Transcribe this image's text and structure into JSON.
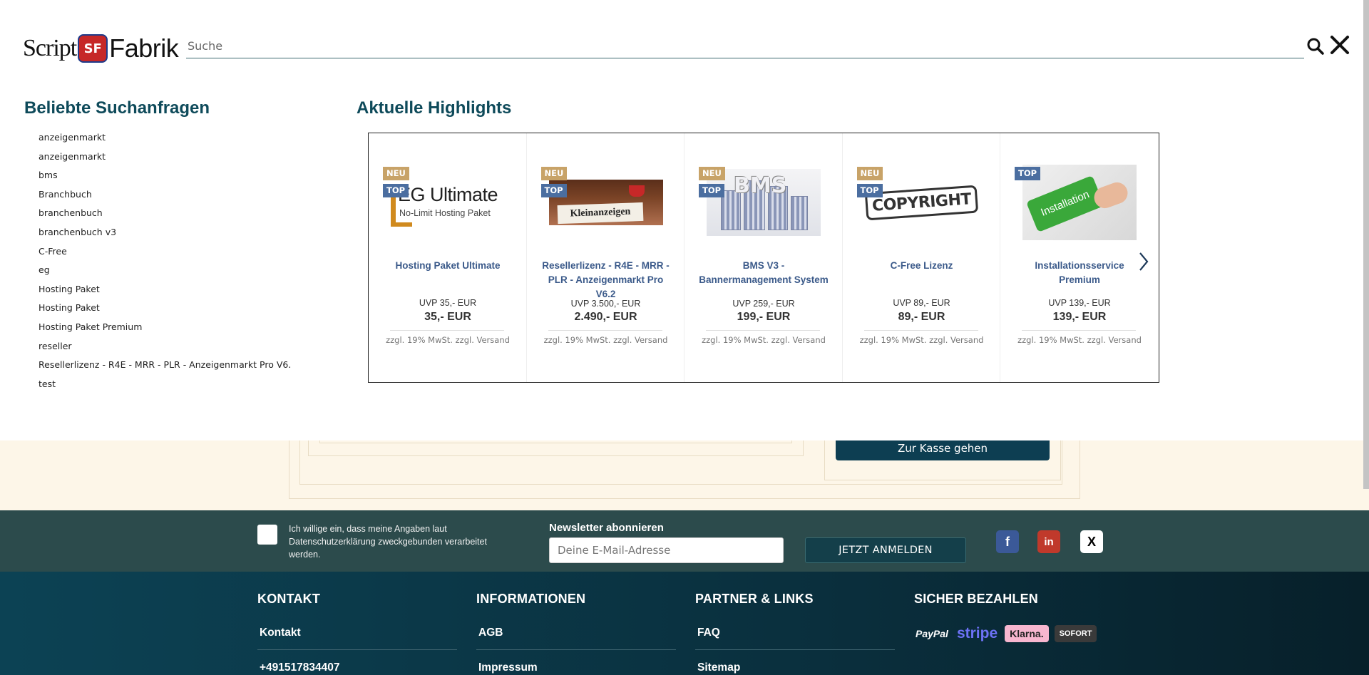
{
  "search": {
    "placeholder": "Suche",
    "logo_part1": "Script",
    "logo_badge": "SF",
    "logo_part2": "Fabrik"
  },
  "popular": {
    "title": "Beliebte Suchanfragen",
    "items": [
      "anzeigenmarkt",
      "anzeigenmarkt",
      "bms",
      "Branchbuch",
      "branchenbuch",
      "branchenbuch v3",
      "C-Free",
      "eg",
      "Hosting Paket",
      "Hosting Paket",
      "Hosting Paket Premium",
      "reseller",
      "Resellerlizenz - R4E - MRR - PLR - Anzeigenmarkt Pro V6.",
      "test"
    ]
  },
  "highlights": {
    "title": "Aktuelle Highlights",
    "products": [
      {
        "title": "Hosting Paket Ultimate",
        "uvp": "UVP 35,- EUR",
        "price": "35,- EUR",
        "tax": "zzgl. 19% MwSt. zzgl. Versand",
        "badge_neu": "NEU",
        "badge_top": "TOP",
        "img_title": "EG Ultimate",
        "img_sub": "No-Limit Hosting Paket"
      },
      {
        "title": "Resellerlizenz - R4E - MRR - PLR - Anzeigenmarkt Pro V6.2",
        "uvp": "UVP 3.500,- EUR",
        "price": "2.490,- EUR",
        "tax": "zzgl. 19% MwSt. zzgl. Versand",
        "badge_neu": "NEU",
        "badge_top": "TOP",
        "img_title": "Kleinanzeigen"
      },
      {
        "title": "BMS V3 - Bannermanagement System",
        "uvp": "UVP 259,- EUR",
        "price": "199,- EUR",
        "tax": "zzgl. 19% MwSt. zzgl. Versand",
        "badge_neu": "NEU",
        "badge_top": "TOP",
        "img_title": "BMS"
      },
      {
        "title": "C-Free Lizenz",
        "uvp": "UVP 89,- EUR",
        "price": "89,- EUR",
        "tax": "zzgl. 19% MwSt. zzgl. Versand",
        "badge_neu": "NEU",
        "badge_top": "TOP",
        "img_title": "COPYRIGHT"
      },
      {
        "title": "Installationsservice Premium",
        "uvp": "UVP 139,- EUR",
        "price": "139,- EUR",
        "tax": "zzgl. 19% MwSt. zzgl. Versand",
        "badge_top": "TOP",
        "img_title": "Installation"
      }
    ]
  },
  "cart": {
    "checkout_label": "Zur Kasse gehen"
  },
  "newsletter": {
    "consent": "Ich willige ein, dass meine Angaben laut Datenschutzerklärung zweckgebunden verarbeitet werden.",
    "title": "Newsletter abonnieren",
    "email_placeholder": "Deine E-Mail-Adresse",
    "submit_label": "JETZT ANMELDEN"
  },
  "social": {
    "facebook": "f",
    "linkedin": "in",
    "x": "X"
  },
  "footer": {
    "kontakt": {
      "title": "KONTAKT",
      "link1": "Kontakt",
      "link2": "+491517834407"
    },
    "info": {
      "title": "INFORMATIONEN",
      "link1": "AGB",
      "link2": "Impressum"
    },
    "partner": {
      "title": "PARTNER & LINKS",
      "link1": "FAQ",
      "link2": "Sitemap"
    },
    "pay": {
      "title": "SICHER BEZAHLEN",
      "paypal": "PayPal",
      "stripe": "stripe",
      "klarna": "Klarna.",
      "sofort": "SOFORT"
    }
  },
  "colors": {
    "accent": "#0e4a5a",
    "badge_neu": "#c8a368",
    "badge_top": "#4b6ea0",
    "newsletter_bg": "#2c4b4c",
    "footer_bg": "#0c4254"
  }
}
